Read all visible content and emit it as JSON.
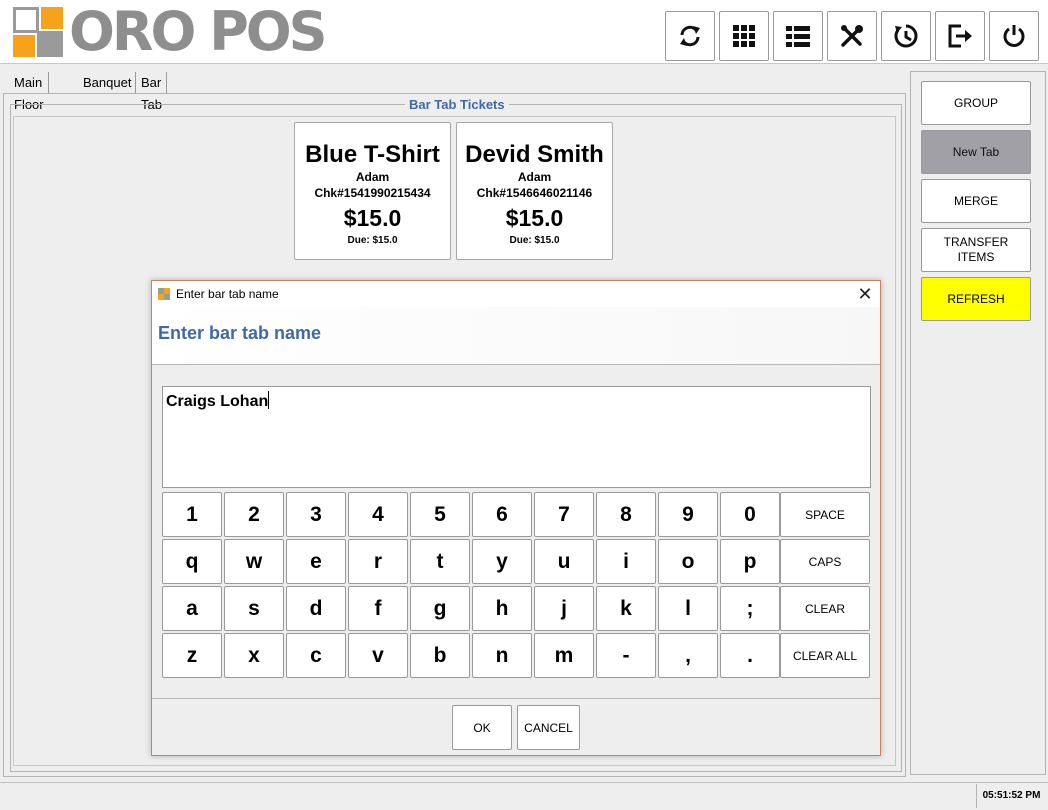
{
  "app": {
    "logo_text": "ORO POS"
  },
  "colors": {
    "accent_blue": "#3f6aa5",
    "logo_orange": "#f7a21b",
    "logo_gray": "#9a9a9a",
    "refresh_yellow": "#ffff00"
  },
  "header_buttons": [
    {
      "icon": "refresh-icon"
    },
    {
      "icon": "grid-icon"
    },
    {
      "icon": "list-icon"
    },
    {
      "icon": "tools-icon"
    },
    {
      "icon": "clock-icon"
    },
    {
      "icon": "logout-icon"
    },
    {
      "icon": "power-icon"
    }
  ],
  "tabs": [
    "Main Floor",
    "Banquet",
    "Bar Tab"
  ],
  "active_tab": "Bar Tab",
  "group_title": "Bar Tab Tickets",
  "tickets": [
    {
      "name": "Blue T-Shirt",
      "server": "Adam",
      "check": "Chk#1541990215434",
      "total": "$15.0",
      "due": "Due: $15.0"
    },
    {
      "name": "Devid Smith",
      "server": "Adam",
      "check": "Chk#1546646021146",
      "total": "$15.0",
      "due": "Due: $15.0"
    }
  ],
  "right_buttons": [
    {
      "label": "GROUP"
    },
    {
      "label": "New Tab"
    },
    {
      "label": "MERGE"
    },
    {
      "label": "TRANSFER ITEMS"
    },
    {
      "label": "REFRESH"
    }
  ],
  "dialog": {
    "window_title": "Enter bar tab name",
    "heading": "Enter bar tab name",
    "input_value": "Craigs Lohan",
    "keyboard": {
      "row1": [
        "1",
        "2",
        "3",
        "4",
        "5",
        "6",
        "7",
        "8",
        "9",
        "0"
      ],
      "row2": [
        "q",
        "w",
        "e",
        "r",
        "t",
        "y",
        "u",
        "i",
        "o",
        "p"
      ],
      "row3": [
        "a",
        "s",
        "d",
        "f",
        "g",
        "h",
        "j",
        "k",
        "l",
        ";"
      ],
      "row4": [
        "z",
        "x",
        "c",
        "v",
        "b",
        "n",
        "m",
        "-",
        ",",
        "."
      ],
      "specials": [
        "SPACE",
        "CAPS",
        "CLEAR",
        "CLEAR ALL"
      ]
    },
    "ok_label": "OK",
    "cancel_label": "CANCEL"
  },
  "status": {
    "clock": "05:51:52 PM"
  }
}
